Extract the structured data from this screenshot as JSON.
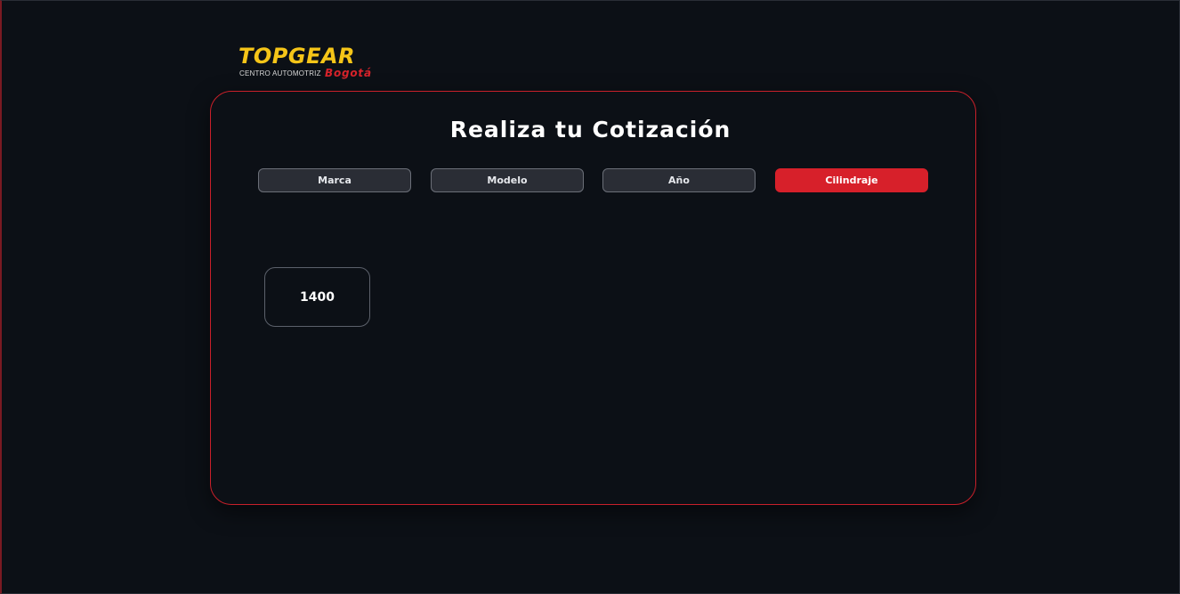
{
  "brand": {
    "name": "TOPGEAR",
    "subtitle": "CENTRO AUTOMOTRIZ",
    "city": "Bogotá"
  },
  "quote": {
    "title": "Realiza tu Cotización",
    "steps": [
      {
        "label": "Marca",
        "active": false
      },
      {
        "label": "Modelo",
        "active": false
      },
      {
        "label": "Año",
        "active": false
      },
      {
        "label": "Cilindraje",
        "active": true
      }
    ],
    "options": [
      "1400"
    ]
  },
  "colors": {
    "accent": "#d7202a",
    "logo_yellow": "#f5c518",
    "background": "#0c1016",
    "step_inactive": "#2a2d35"
  }
}
